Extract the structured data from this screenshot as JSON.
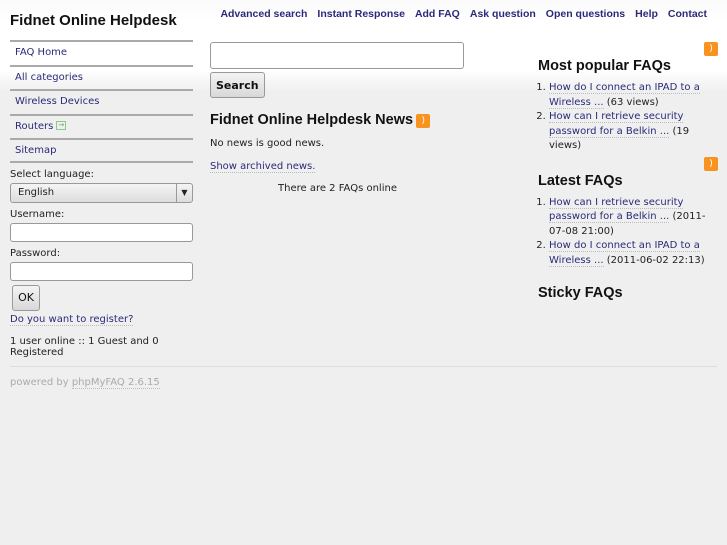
{
  "header": {
    "title": "Fidnet Online Helpdesk",
    "nav": [
      "Advanced search",
      "Instant Response",
      "Add FAQ",
      "Ask question",
      "Open questions",
      "Help",
      "Contact"
    ]
  },
  "sidebar": {
    "menu": [
      "FAQ Home",
      "All categories",
      "Wireless Devices",
      "Routers",
      "Sitemap"
    ],
    "language_label": "Select language:",
    "language_value": "English",
    "username_label": "Username:",
    "password_label": "Password:",
    "ok_label": "OK",
    "register_link": "Do you want to register?",
    "online": "1 user online :: 1 Guest and 0 Registered"
  },
  "center": {
    "search_button": "Search",
    "news_title": "Fidnet Online Helpdesk News",
    "news_text": "No news is good news.",
    "archive_link": "Show archived news.",
    "faq_count": "There are 2 FAQs online"
  },
  "right": {
    "popular_title": "Most popular FAQs",
    "popular": [
      {
        "link": "How do I connect an IPAD to a Wireless ...",
        "meta": "(63 views)"
      },
      {
        "link": "How can I retrieve security password for a Belkin ...",
        "meta": "(19 views)"
      }
    ],
    "latest_title": "Latest FAQs",
    "latest": [
      {
        "link": "How can I retrieve security password for a Belkin ...",
        "meta": "(2011-07-08 21:00)"
      },
      {
        "link": "How do I connect an IPAD to a Wireless ...",
        "meta": "(2011-06-02 22:13)"
      }
    ],
    "sticky_title": "Sticky FAQs"
  },
  "footer": {
    "prefix": "powered by",
    "link": "phpMyFAQ 2.6.15"
  }
}
